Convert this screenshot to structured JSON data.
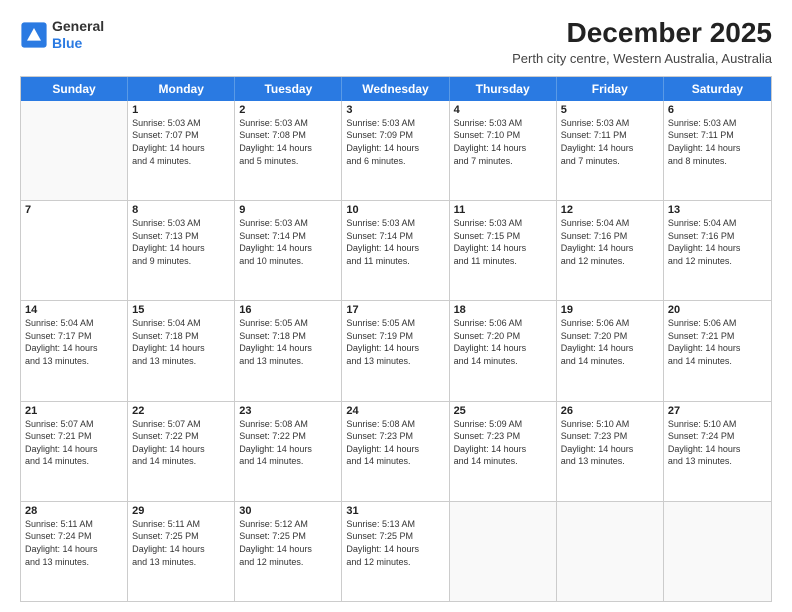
{
  "logo": {
    "line1": "General",
    "line2": "Blue"
  },
  "title": "December 2025",
  "subtitle": "Perth city centre, Western Australia, Australia",
  "days": [
    "Sunday",
    "Monday",
    "Tuesday",
    "Wednesday",
    "Thursday",
    "Friday",
    "Saturday"
  ],
  "weeks": [
    [
      {
        "date": "",
        "info": ""
      },
      {
        "date": "1",
        "info": "Sunrise: 5:03 AM\nSunset: 7:07 PM\nDaylight: 14 hours\nand 4 minutes."
      },
      {
        "date": "2",
        "info": "Sunrise: 5:03 AM\nSunset: 7:08 PM\nDaylight: 14 hours\nand 5 minutes."
      },
      {
        "date": "3",
        "info": "Sunrise: 5:03 AM\nSunset: 7:09 PM\nDaylight: 14 hours\nand 6 minutes."
      },
      {
        "date": "4",
        "info": "Sunrise: 5:03 AM\nSunset: 7:10 PM\nDaylight: 14 hours\nand 7 minutes."
      },
      {
        "date": "5",
        "info": "Sunrise: 5:03 AM\nSunset: 7:11 PM\nDaylight: 14 hours\nand 7 minutes."
      },
      {
        "date": "6",
        "info": "Sunrise: 5:03 AM\nSunset: 7:11 PM\nDaylight: 14 hours\nand 8 minutes."
      }
    ],
    [
      {
        "date": "7",
        "info": ""
      },
      {
        "date": "8",
        "info": "Sunrise: 5:03 AM\nSunset: 7:13 PM\nDaylight: 14 hours\nand 9 minutes."
      },
      {
        "date": "9",
        "info": "Sunrise: 5:03 AM\nSunset: 7:14 PM\nDaylight: 14 hours\nand 10 minutes."
      },
      {
        "date": "10",
        "info": "Sunrise: 5:03 AM\nSunset: 7:14 PM\nDaylight: 14 hours\nand 11 minutes."
      },
      {
        "date": "11",
        "info": "Sunrise: 5:03 AM\nSunset: 7:15 PM\nDaylight: 14 hours\nand 11 minutes."
      },
      {
        "date": "12",
        "info": "Sunrise: 5:04 AM\nSunset: 7:16 PM\nDaylight: 14 hours\nand 12 minutes."
      },
      {
        "date": "13",
        "info": "Sunrise: 5:04 AM\nSunset: 7:16 PM\nDaylight: 14 hours\nand 12 minutes."
      }
    ],
    [
      {
        "date": "14",
        "info": "Sunrise: 5:04 AM\nSunset: 7:17 PM\nDaylight: 14 hours\nand 13 minutes."
      },
      {
        "date": "15",
        "info": "Sunrise: 5:04 AM\nSunset: 7:18 PM\nDaylight: 14 hours\nand 13 minutes."
      },
      {
        "date": "16",
        "info": "Sunrise: 5:05 AM\nSunset: 7:18 PM\nDaylight: 14 hours\nand 13 minutes."
      },
      {
        "date": "17",
        "info": "Sunrise: 5:05 AM\nSunset: 7:19 PM\nDaylight: 14 hours\nand 13 minutes."
      },
      {
        "date": "18",
        "info": "Sunrise: 5:06 AM\nSunset: 7:20 PM\nDaylight: 14 hours\nand 14 minutes."
      },
      {
        "date": "19",
        "info": "Sunrise: 5:06 AM\nSunset: 7:20 PM\nDaylight: 14 hours\nand 14 minutes."
      },
      {
        "date": "20",
        "info": "Sunrise: 5:06 AM\nSunset: 7:21 PM\nDaylight: 14 hours\nand 14 minutes."
      }
    ],
    [
      {
        "date": "21",
        "info": "Sunrise: 5:07 AM\nSunset: 7:21 PM\nDaylight: 14 hours\nand 14 minutes."
      },
      {
        "date": "22",
        "info": "Sunrise: 5:07 AM\nSunset: 7:22 PM\nDaylight: 14 hours\nand 14 minutes."
      },
      {
        "date": "23",
        "info": "Sunrise: 5:08 AM\nSunset: 7:22 PM\nDaylight: 14 hours\nand 14 minutes."
      },
      {
        "date": "24",
        "info": "Sunrise: 5:08 AM\nSunset: 7:23 PM\nDaylight: 14 hours\nand 14 minutes."
      },
      {
        "date": "25",
        "info": "Sunrise: 5:09 AM\nSunset: 7:23 PM\nDaylight: 14 hours\nand 14 minutes."
      },
      {
        "date": "26",
        "info": "Sunrise: 5:10 AM\nSunset: 7:23 PM\nDaylight: 14 hours\nand 13 minutes."
      },
      {
        "date": "27",
        "info": "Sunrise: 5:10 AM\nSunset: 7:24 PM\nDaylight: 14 hours\nand 13 minutes."
      }
    ],
    [
      {
        "date": "28",
        "info": "Sunrise: 5:11 AM\nSunset: 7:24 PM\nDaylight: 14 hours\nand 13 minutes."
      },
      {
        "date": "29",
        "info": "Sunrise: 5:11 AM\nSunset: 7:25 PM\nDaylight: 14 hours\nand 13 minutes."
      },
      {
        "date": "30",
        "info": "Sunrise: 5:12 AM\nSunset: 7:25 PM\nDaylight: 14 hours\nand 12 minutes."
      },
      {
        "date": "31",
        "info": "Sunrise: 5:13 AM\nSunset: 7:25 PM\nDaylight: 14 hours\nand 12 minutes."
      },
      {
        "date": "",
        "info": ""
      },
      {
        "date": "",
        "info": ""
      },
      {
        "date": "",
        "info": ""
      }
    ]
  ]
}
